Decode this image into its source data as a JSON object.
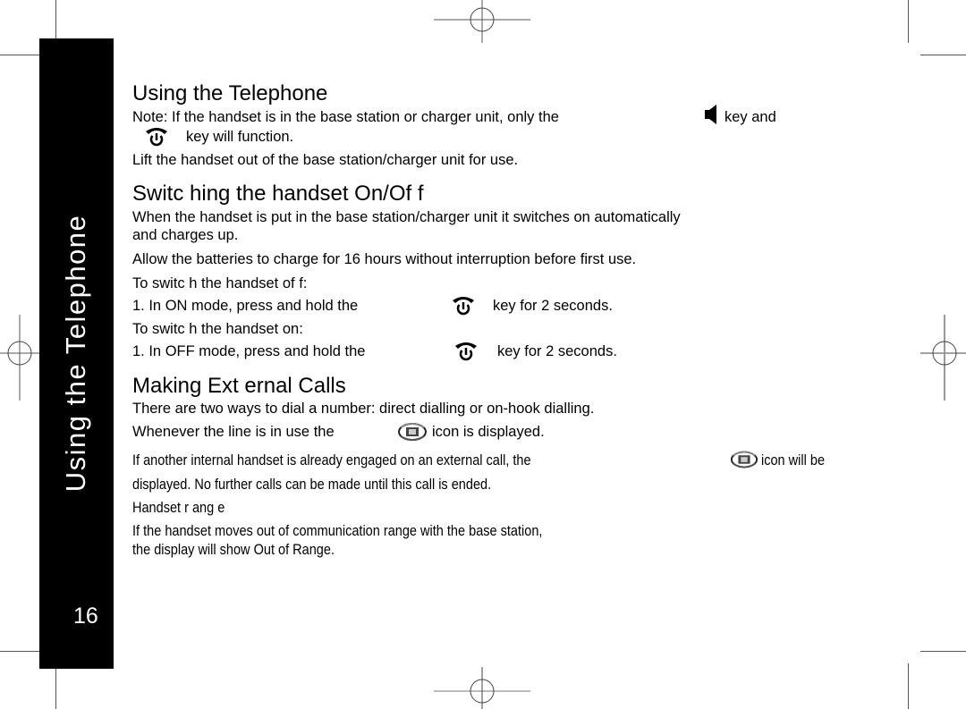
{
  "sidebar": {
    "title": "Using the Telephone",
    "page_number": "16"
  },
  "sections": {
    "using": {
      "heading": "Using the  Telephone",
      "note_a": "Note: If the handset is in the base station or charger unit, only the",
      "note_b": "key and",
      "note_c": "key will function.",
      "lift": "Lift the handset out of the base station/charger unit for use."
    },
    "switching": {
      "heading": "Switc hing the handset On/Of   f",
      "p1_line1": "When the handset is put in the base station/charger unit it switches on automatically",
      "p1_line2": "and charges up.",
      "p2": "Allow the batteries to charge for 16 hours without interruption before first use.",
      "off_label": "To switc h the handset of  f:",
      "off_step_a": "1.  In ON mode, press and hold the",
      "off_step_b": "key for 2 seconds.",
      "on_label": "To switc h the handset on:",
      "on_step_a": "1.  In OFF mode, press and hold the",
      "on_step_b": "key for 2 seconds."
    },
    "external": {
      "heading": "Making Ext  ernal Calls",
      "p1": "There are two ways to dial a number: direct dialling or on-hook dialling.",
      "p2_a": "Whenever the line is in use the",
      "p2_b": "icon is displayed.",
      "p3_a": "If another internal handset is already engaged on an external call, the",
      "p3_b": "icon will be",
      "p3_line2": "displayed. No further calls can be made until this call is ended.",
      "range_label": "Handset r ang e",
      "range_line1": "If the handset moves out of communication range with the base station,",
      "range_line2": "the display will show    Out of Range."
    }
  },
  "icons": {
    "speaker": "speaker-key-icon",
    "power": "end-call-power-key-icon",
    "line": "line-in-use-icon"
  }
}
